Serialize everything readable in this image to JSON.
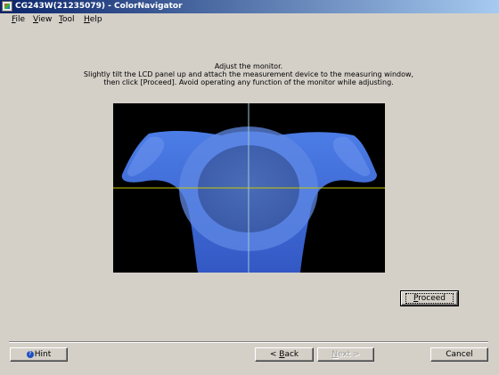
{
  "window": {
    "title": "CG243W(21235079) - ColorNavigator"
  },
  "menu": {
    "file": {
      "hotkey": "F",
      "rest": "ile"
    },
    "view": {
      "hotkey": "V",
      "rest": "iew"
    },
    "tool": {
      "hotkey": "T",
      "rest": "ool"
    },
    "help": {
      "hotkey": "H",
      "rest": "elp"
    }
  },
  "instructions": {
    "line1": "Adjust the monitor.",
    "line2": "Slightly tilt the LCD panel up and attach the measurement device to the measuring window,",
    "line3": "then click [Proceed].  Avoid operating any function of the monitor while adjusting."
  },
  "buttons": {
    "proceed": {
      "hotkey": "P",
      "rest": "roceed"
    },
    "hint": {
      "label": "Hint"
    },
    "back": {
      "prefix": "< ",
      "hotkey": "B",
      "rest": "ack"
    },
    "next": {
      "hotkey": "N",
      "rest": "ext >",
      "enabled": false
    },
    "cancel": {
      "label": "Cancel"
    }
  },
  "colors": {
    "titlebar_start": "#0a246a",
    "titlebar_end": "#a6caf0",
    "dialog_bg": "#d4d0c8",
    "device_blue": "#3f6ed8",
    "crosshair_horizontal": "#c8c800",
    "crosshair_vertical": "#9ec8d8"
  },
  "icons": {
    "app": "colornavigator-app-icon",
    "hint": "hint-icon"
  }
}
